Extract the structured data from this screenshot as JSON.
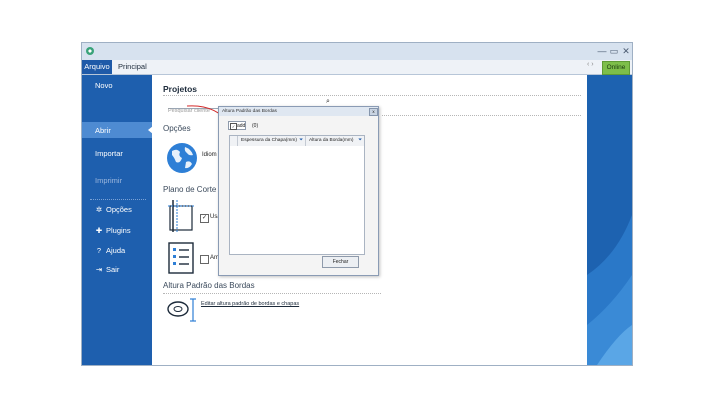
{
  "window": {
    "app_icon": "app-logo-icon",
    "controls": [
      "—",
      "▭",
      "✕"
    ]
  },
  "ribbon": {
    "file_tab": "Arquivo",
    "home_tab": "Principal",
    "nav_arrows": "‹ ›",
    "status_badge": "Online"
  },
  "sidebar": {
    "items": [
      {
        "label": "Novo"
      },
      {
        "label": "Abrir"
      },
      {
        "label": "Importar"
      },
      {
        "label": "Imprimir"
      },
      {
        "label": "Opções",
        "icon": "gear-icon"
      },
      {
        "label": "Plugins",
        "icon": "puzzle-icon"
      },
      {
        "label": "Ajuda",
        "icon": "help-icon"
      },
      {
        "label": "Sair",
        "icon": "exit-icon"
      }
    ]
  },
  "main": {
    "projects_title": "Projetos",
    "search_placeholder": "Pesquisar cliente",
    "options_heading": "Opções",
    "language_label": "Idiom",
    "cut_plan_heading": "Plano de Corte",
    "use_checkbox_label": "Usa",
    "am_checkbox_label": "Am",
    "edge_height_heading": "Altura Padrão das Bordas",
    "edge_height_link": "Editar altura padrão de bordas e chapas"
  },
  "dialog": {
    "title": "Altura Padrão das Bordas",
    "close_x": "x",
    "toolbar_add": "add",
    "toolbar_count": "(0)",
    "columns": [
      "Espessura da Chapa(mm)",
      "Altura da Borda(mm)"
    ],
    "close_button": "Fechar"
  }
}
